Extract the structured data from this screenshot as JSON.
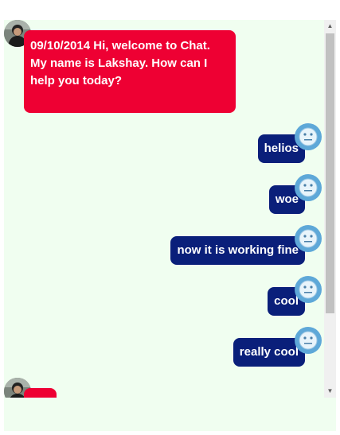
{
  "chat": {
    "messages": [
      {
        "sender": "agent",
        "date": "09/10/2014",
        "text": "Hi, welcome to Chat. My name is Lakshay. How can I help you today?"
      },
      {
        "sender": "user",
        "text": "helios"
      },
      {
        "sender": "user",
        "text": "woe"
      },
      {
        "sender": "user",
        "text": "now it is working fine"
      },
      {
        "sender": "user",
        "text": "cool"
      },
      {
        "sender": "user",
        "text": "really cool"
      },
      {
        "sender": "agent",
        "text": ""
      }
    ]
  },
  "icons": {
    "agent_avatar": "avatar-photo",
    "user_avatar": "smiley-face-icon",
    "scroll_up": "chevron-up-icon",
    "scroll_down": "chevron-down-icon"
  },
  "colors": {
    "panel_background": "#f0fef0",
    "agent_bubble": "#ee0033",
    "user_bubble": "#0a1f7a",
    "user_avatar": "#5ea8d8",
    "scrollbar_thumb": "#c1c1c1"
  }
}
